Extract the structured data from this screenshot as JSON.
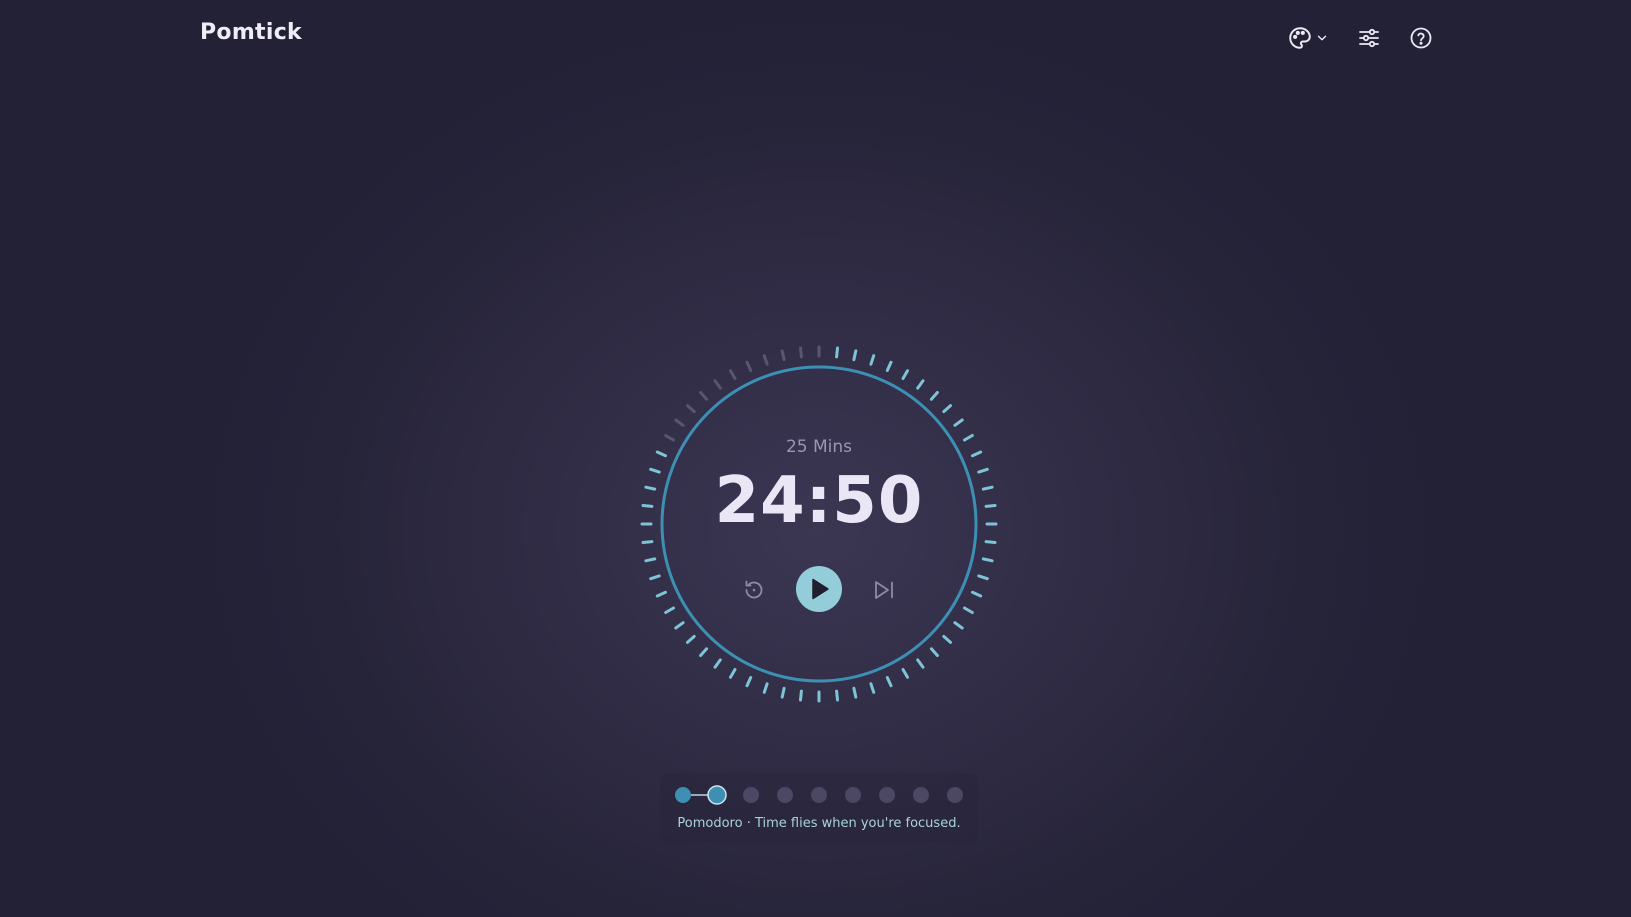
{
  "app": {
    "title": "Pomtick"
  },
  "header": {
    "theme_icon": "palette-icon",
    "theme_chevron_icon": "chevron-down-icon",
    "settings_icon": "sliders-icon",
    "help_icon": "question-circle-icon"
  },
  "timer": {
    "session_length": "25 Mins",
    "time_remaining": "24:50",
    "progress": 0.05,
    "tick_count": 60,
    "reset_icon": "reset-icon",
    "play_icon": "play-icon",
    "skip_icon": "skip-next-icon"
  },
  "sessions": {
    "total": 9,
    "completed": 1,
    "current_index": 1,
    "caption": "Pomodoro · Time flies when you're focused."
  },
  "colors": {
    "accent": "#3d8fb3",
    "tick_active": "#7fc4d6",
    "tick_inactive": "#5a566e",
    "play_button": "#93cdd9",
    "pip_inactive": "#4c4863"
  }
}
